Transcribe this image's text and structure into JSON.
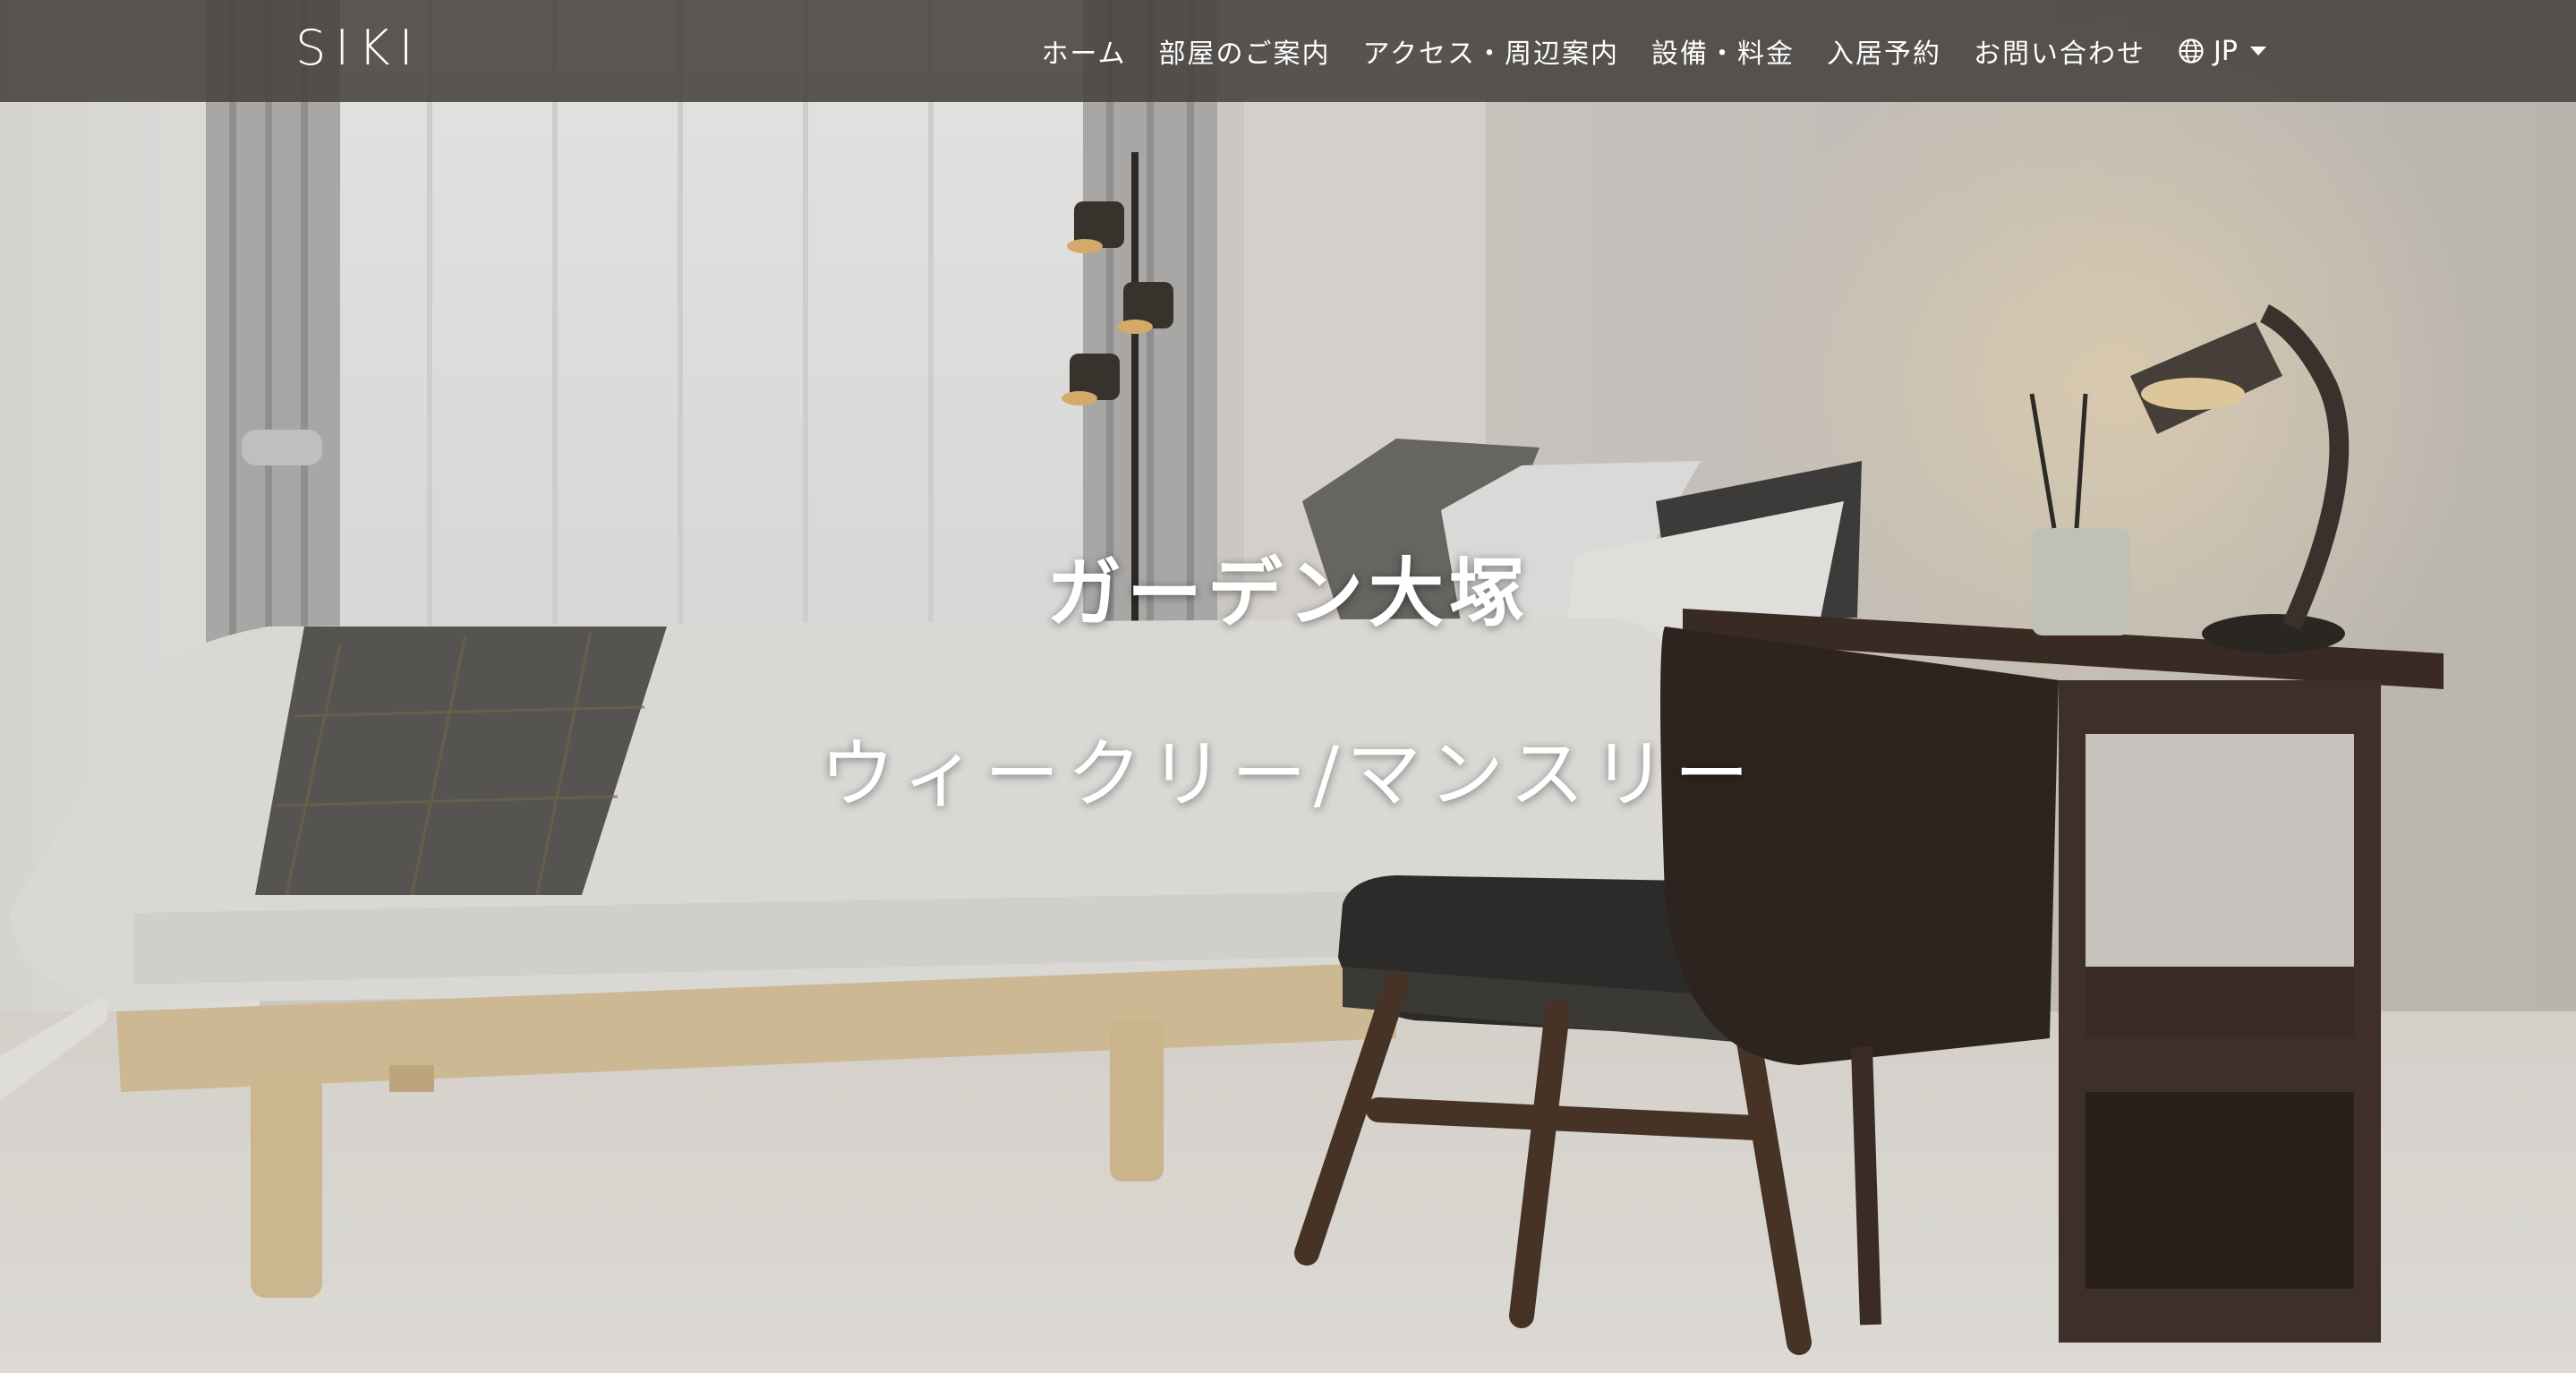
{
  "brand": {
    "name": "SIKI"
  },
  "nav": {
    "items": [
      {
        "label": "ホーム"
      },
      {
        "label": "部屋のご案内"
      },
      {
        "label": "アクセス・周辺案内"
      },
      {
        "label": "設備・料金"
      },
      {
        "label": "入居予約"
      },
      {
        "label": "お問い合わせ"
      }
    ],
    "language": {
      "icon": "globe-icon",
      "label": "JP"
    }
  },
  "hero": {
    "title": "ガーデン大塚",
    "subtitle": "ウィークリー/マンスリー",
    "image": "bedroom-photo"
  },
  "colors": {
    "navbar": "#46423f",
    "text": "#ffffff"
  }
}
